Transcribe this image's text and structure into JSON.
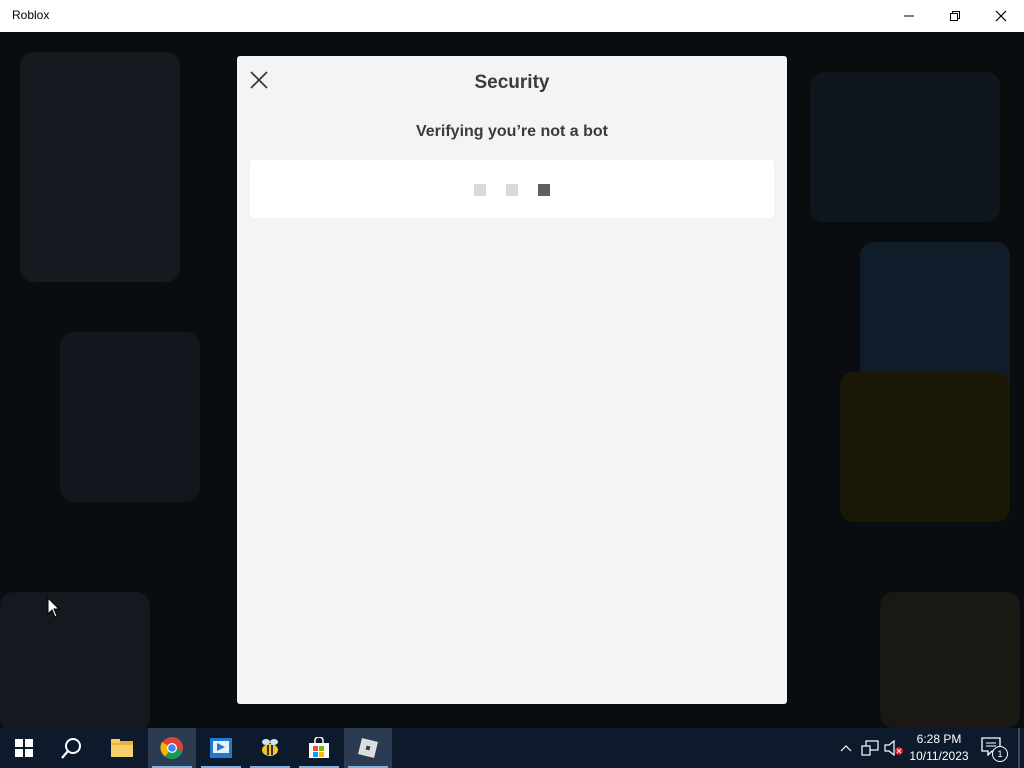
{
  "window": {
    "title": "Roblox"
  },
  "dialog": {
    "title": "Security",
    "subtitle": "Verifying you’re not a bot"
  },
  "taskbar": {
    "apps": [
      {
        "name": "start-button",
        "icon": "windows-logo-icon"
      },
      {
        "name": "search-button",
        "icon": "search-icon"
      },
      {
        "name": "file-explorer",
        "icon": "folder-icon"
      },
      {
        "name": "chrome",
        "icon": "chrome-icon"
      },
      {
        "name": "remote-app",
        "icon": "remote-desktop-icon"
      },
      {
        "name": "bee-app",
        "icon": "bee-icon"
      },
      {
        "name": "microsoft-store",
        "icon": "store-bag-icon"
      },
      {
        "name": "roblox",
        "icon": "roblox-icon"
      }
    ],
    "clock_time": "6:28 PM",
    "clock_date": "10/11/2023",
    "notification_count": "1"
  },
  "colors": {
    "dialog_bg": "#f2f4f5",
    "text": "#393b3d",
    "taskbar_bg": "#0d1a2b"
  }
}
